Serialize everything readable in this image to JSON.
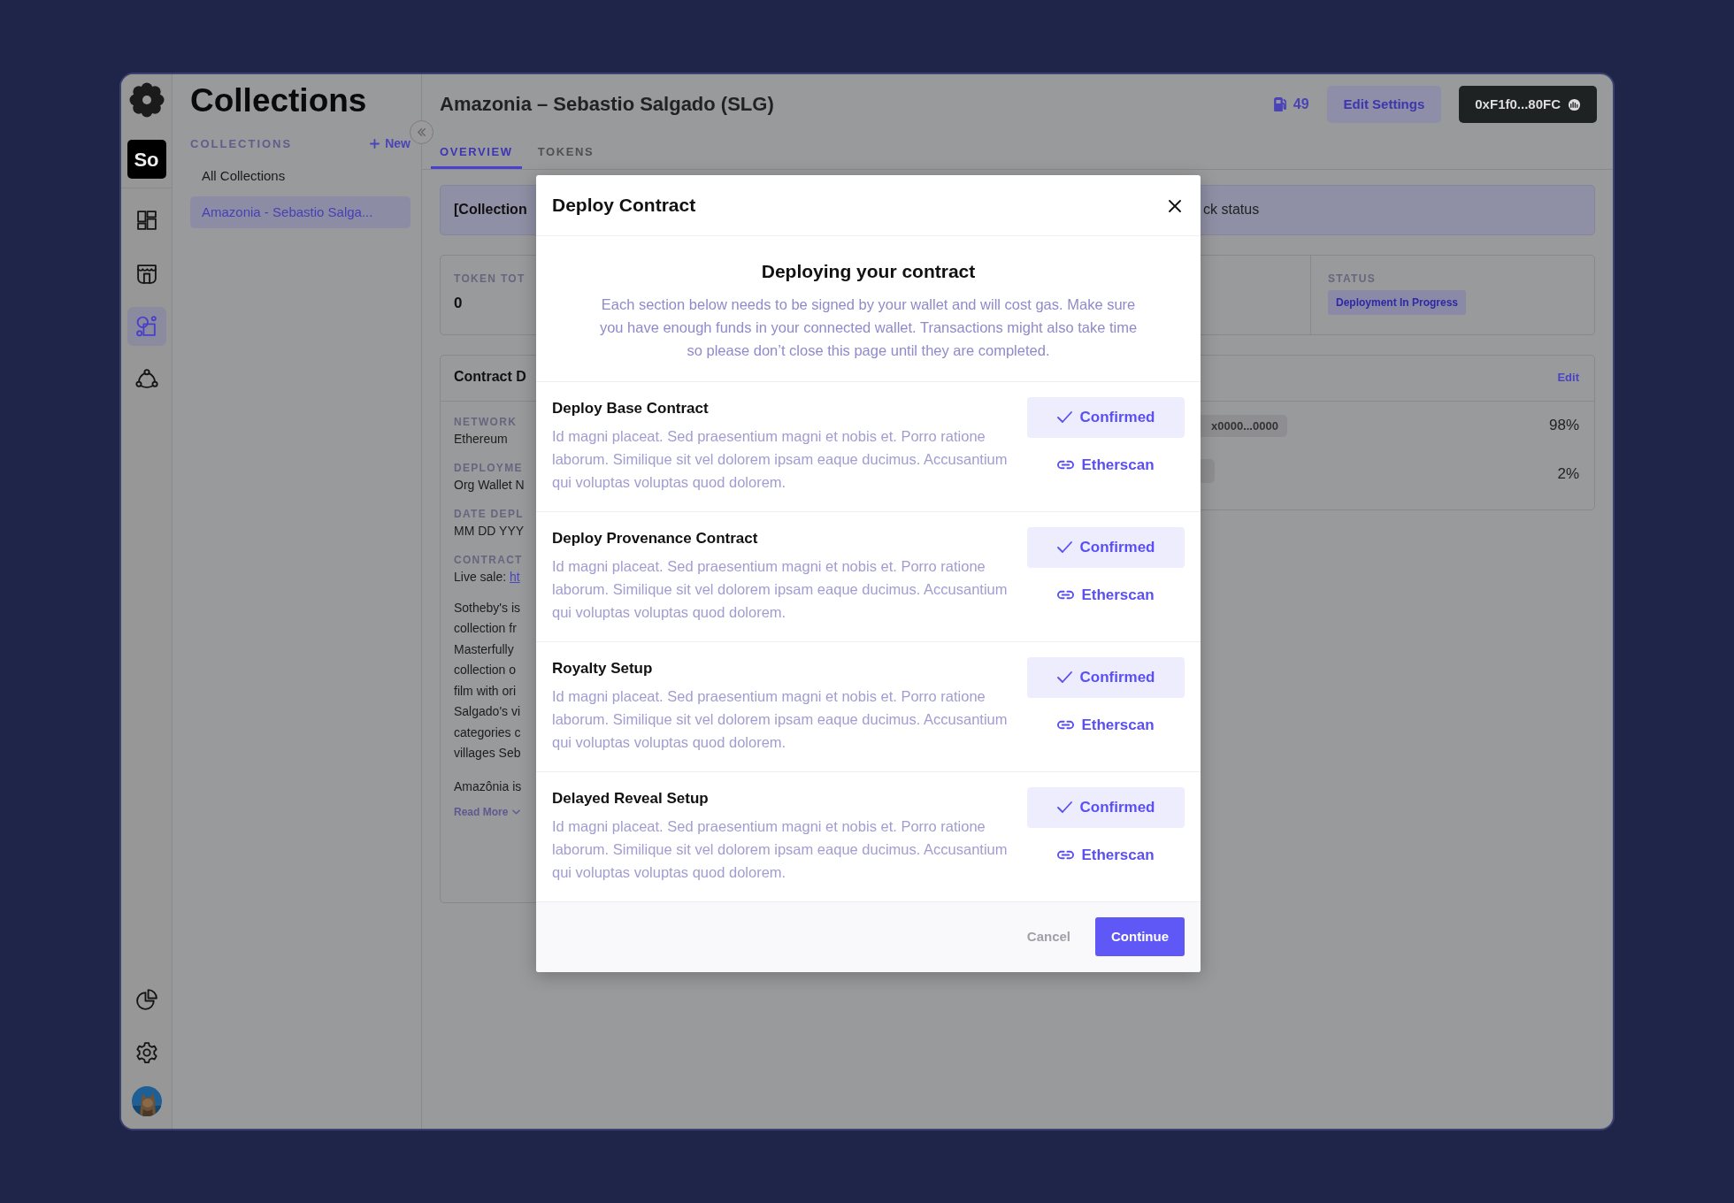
{
  "rail": {
    "workspace": "So",
    "nav": [
      {
        "kind": "grid",
        "selected": false
      },
      {
        "kind": "store",
        "selected": false
      },
      {
        "kind": "shapes",
        "selected": true
      },
      {
        "kind": "network",
        "selected": false
      }
    ],
    "bottom": [
      {
        "kind": "pie",
        "selected": false
      },
      {
        "kind": "gear",
        "selected": false
      }
    ]
  },
  "collections_panel": {
    "title": "Collections",
    "section_label": "COLLECTIONS",
    "new_button": "New",
    "items": [
      {
        "label": "All Collections",
        "selected": false
      },
      {
        "label": "Amazonia - Sebastio Salga...",
        "selected": true
      }
    ]
  },
  "header": {
    "title": "Amazonia – Sebastio Salgado (SLG)",
    "gas": "49",
    "edit_button": "Edit Settings",
    "wallet_button": "0xF1f0...80FC"
  },
  "tabs": [
    {
      "label": "OVERVIEW",
      "selected": true
    },
    {
      "label": "TOKENS",
      "selected": false
    }
  ],
  "banner": {
    "left": "[Collection",
    "right": "ck status"
  },
  "stats": {
    "token_label": "TOKEN TOT",
    "token_value": "0",
    "status_label": "STATUS",
    "status_badge": "Deployment In Progress"
  },
  "contract_card": {
    "title": "Contract D",
    "fields": [
      {
        "label": "NETWORK",
        "value": "Ethereum"
      },
      {
        "label": "DEPLOYME",
        "value": "Org Wallet N"
      },
      {
        "label": "DATE DEPL",
        "value": "MM DD YYY"
      },
      {
        "label": "CONTRACT",
        "value": "Live sale:",
        "link": "ht"
      }
    ],
    "paragraphs": [
      [
        "Sotheby's is",
        "collection fr",
        "Masterfully",
        "collection o",
        "film with ori",
        "Salgado's vi",
        "categories c",
        "villages Seb"
      ],
      [
        "Amazônia is"
      ]
    ],
    "read_more": "Read More"
  },
  "split_card": {
    "edit": "Edit",
    "rows": [
      {
        "address": "x0000...0000",
        "share": "98%"
      },
      {
        "share": "2%"
      }
    ]
  },
  "modal": {
    "title": "Deploy Contract",
    "heading": "Deploying your contract",
    "intro": "Each section below needs to be signed by your wallet and will cost gas. Make sure you have enough funds in your connected wallet. Transactions might also take time so please don’t close this page until they are completed.",
    "steps": [
      {
        "title": "Deploy Base Contract",
        "description": "Id magni placeat. Sed praesentium magni et nobis et. Porro ratione laborum. Similique sit vel dolorem ipsam eaque ducimus. Accusantium qui voluptas voluptas quod dolorem.",
        "status": "Confirmed",
        "confirmed": true,
        "link": "Etherscan"
      },
      {
        "title": "Deploy Provenance Contract",
        "description": "Id magni placeat. Sed praesentium magni et nobis et. Porro ratione laborum. Similique sit vel dolorem ipsam eaque ducimus. Accusantium qui voluptas voluptas quod dolorem.",
        "status": "Confirmed",
        "confirmed": true,
        "link": "Etherscan"
      },
      {
        "title": "Royalty Setup",
        "description": "Id magni placeat. Sed praesentium magni et nobis et. Porro ratione laborum. Similique sit vel dolorem ipsam eaque ducimus. Accusantium qui voluptas voluptas quod dolorem.",
        "status": "Confirmed",
        "confirmed": true,
        "link": "Etherscan"
      },
      {
        "title": "Delayed Reveal Setup",
        "description": "Id magni placeat. Sed praesentium magni et nobis et. Porro ratione laborum. Similique sit vel dolorem ipsam eaque ducimus. Accusantium qui voluptas voluptas quod dolorem.",
        "status": "Confirmed",
        "confirmed": true,
        "link": "Etherscan"
      }
    ],
    "cancel": "Cancel",
    "continue": "Continue"
  }
}
